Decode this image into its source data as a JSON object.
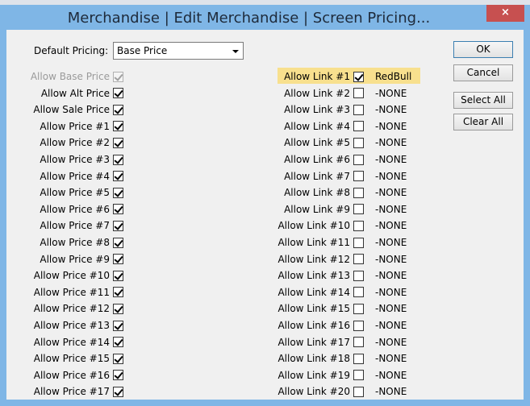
{
  "window": {
    "title": "Merchandise | Edit Merchandise | Screen Pricing...",
    "close_glyph": "×"
  },
  "default_pricing": {
    "label": "Default Pricing:",
    "value": "Base Price"
  },
  "price_rows": [
    {
      "label": "Allow Base Price",
      "checked": true,
      "disabled": true
    },
    {
      "label": "Allow Alt Price",
      "checked": true,
      "disabled": false
    },
    {
      "label": "Allow Sale Price",
      "checked": true,
      "disabled": false
    },
    {
      "label": "Allow Price #1",
      "checked": true,
      "disabled": false
    },
    {
      "label": "Allow Price #2",
      "checked": true,
      "disabled": false
    },
    {
      "label": "Allow Price #3",
      "checked": true,
      "disabled": false
    },
    {
      "label": "Allow Price #4",
      "checked": true,
      "disabled": false
    },
    {
      "label": "Allow Price #5",
      "checked": true,
      "disabled": false
    },
    {
      "label": "Allow Price #6",
      "checked": true,
      "disabled": false
    },
    {
      "label": "Allow Price #7",
      "checked": true,
      "disabled": false
    },
    {
      "label": "Allow Price #8",
      "checked": true,
      "disabled": false
    },
    {
      "label": "Allow Price #9",
      "checked": true,
      "disabled": false
    },
    {
      "label": "Allow Price #10",
      "checked": true,
      "disabled": false
    },
    {
      "label": "Allow Price #11",
      "checked": true,
      "disabled": false
    },
    {
      "label": "Allow Price #12",
      "checked": true,
      "disabled": false
    },
    {
      "label": "Allow Price #13",
      "checked": true,
      "disabled": false
    },
    {
      "label": "Allow Price #14",
      "checked": true,
      "disabled": false
    },
    {
      "label": "Allow Price #15",
      "checked": true,
      "disabled": false
    },
    {
      "label": "Allow Price #16",
      "checked": true,
      "disabled": false
    },
    {
      "label": "Allow Price #17",
      "checked": true,
      "disabled": false
    }
  ],
  "link_rows": [
    {
      "label": "Allow Link #1",
      "checked": true,
      "value": "RedBull",
      "highlighted": true
    },
    {
      "label": "Allow Link #2",
      "checked": false,
      "value": "-NONE"
    },
    {
      "label": "Allow Link #3",
      "checked": false,
      "value": "-NONE"
    },
    {
      "label": "Allow Link #4",
      "checked": false,
      "value": "-NONE"
    },
    {
      "label": "Allow Link #5",
      "checked": false,
      "value": "-NONE"
    },
    {
      "label": "Allow Link #6",
      "checked": false,
      "value": "-NONE"
    },
    {
      "label": "Allow Link #7",
      "checked": false,
      "value": "-NONE"
    },
    {
      "label": "Allow Link #8",
      "checked": false,
      "value": "-NONE"
    },
    {
      "label": "Allow Link #9",
      "checked": false,
      "value": "-NONE"
    },
    {
      "label": "Allow Link #10",
      "checked": false,
      "value": "-NONE"
    },
    {
      "label": "Allow Link #11",
      "checked": false,
      "value": "-NONE"
    },
    {
      "label": "Allow Link #12",
      "checked": false,
      "value": "-NONE"
    },
    {
      "label": "Allow Link #13",
      "checked": false,
      "value": "-NONE"
    },
    {
      "label": "Allow Link #14",
      "checked": false,
      "value": "-NONE"
    },
    {
      "label": "Allow Link #15",
      "checked": false,
      "value": "-NONE"
    },
    {
      "label": "Allow Link #16",
      "checked": false,
      "value": "-NONE"
    },
    {
      "label": "Allow Link #17",
      "checked": false,
      "value": "-NONE"
    },
    {
      "label": "Allow Link #18",
      "checked": false,
      "value": "-NONE"
    },
    {
      "label": "Allow Link #19",
      "checked": false,
      "value": "-NONE"
    },
    {
      "label": "Allow Link #20",
      "checked": false,
      "value": "-NONE"
    }
  ],
  "buttons": {
    "ok": "OK",
    "cancel": "Cancel",
    "select_all": "Select All",
    "clear_all": "Clear All"
  },
  "colors": {
    "titlebar": "#7fb6e6",
    "close": "#c75050",
    "highlight": "#f8e08e"
  }
}
